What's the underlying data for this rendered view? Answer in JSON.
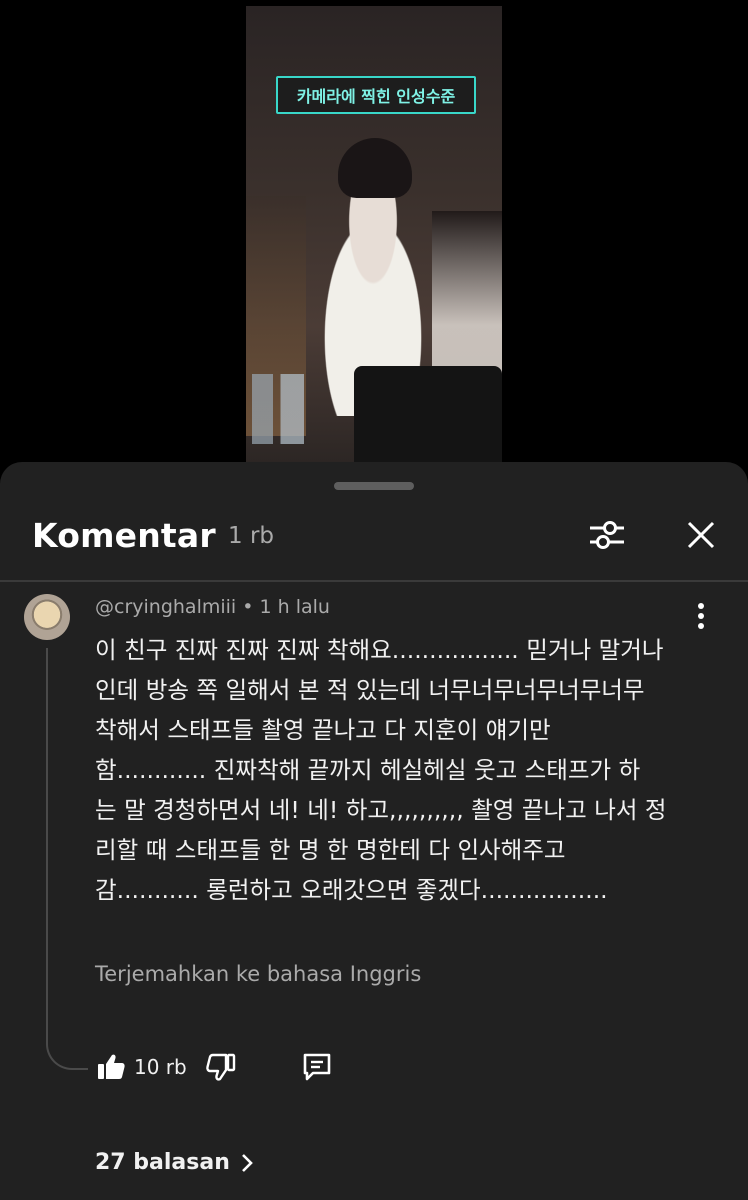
{
  "video": {
    "caption": "카메라에 찍힌 인성수준"
  },
  "header": {
    "title": "Komentar",
    "count": "1 rb"
  },
  "comment": {
    "author": "@cryinghalmiii",
    "separator": " • ",
    "time": "1 h lalu",
    "text": "이 친구 진짜 진짜 진짜 착해요................. 믿거나 말거나\n인데 방송 쪽 일해서 본 적 있는데 너무너무너무너무너무\n착해서 스태프들 촬영 끝나고 다 지훈이 얘기만\n함............ 진짜착해 끝까지 헤실헤실 웃고 스태프가 하\n는 말 경청하면서 네! 네! 하고,,,,,,,,,, 촬영 끝나고 나서 정\n리할 때 스태프들 한 명 한 명한테 다 인사해주고\n감........... 롱런하고 오래갓으면 좋겠다.................",
    "translate_label": "Terjemahkan ke bahasa Inggris",
    "like_count": "10 rb",
    "replies_label": "27 balasan"
  },
  "icons": {
    "filter": "filter-sliders-icon",
    "close": "close-icon",
    "more": "more-vert-icon",
    "like": "thumbs-up-icon",
    "dislike": "thumbs-down-icon",
    "reply": "reply-icon",
    "chevron": "chevron-right-icon"
  },
  "colors": {
    "sheet_bg": "#212121",
    "caption_border": "#39d7c9",
    "secondary_text": "#aaaaaa"
  }
}
